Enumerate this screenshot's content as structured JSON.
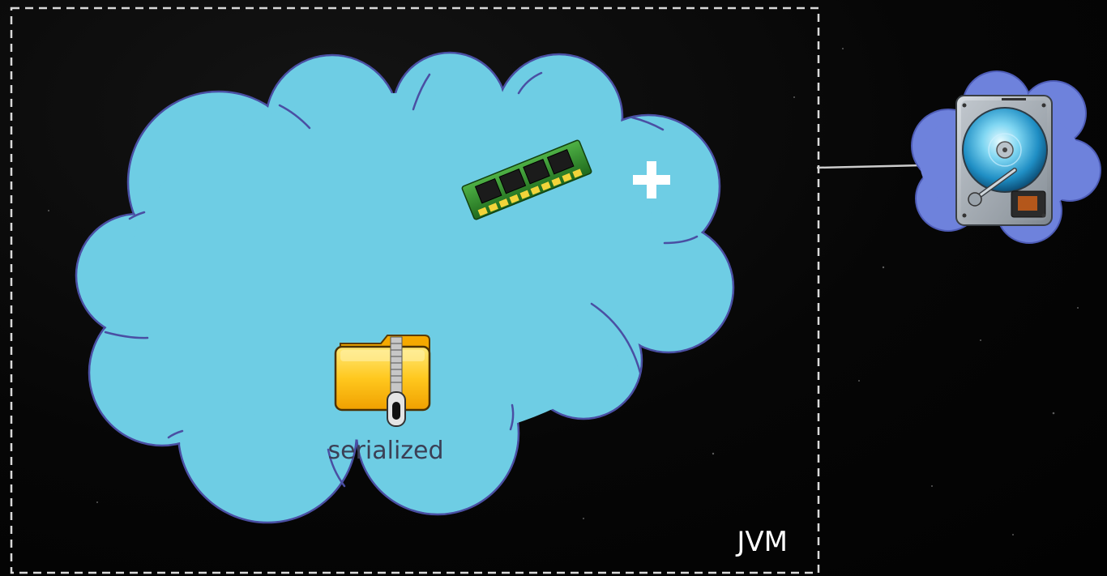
{
  "diagram": {
    "jvm_label": "JVM",
    "serialized_label": "serialized",
    "plus_symbol": "+"
  },
  "icons": {
    "memory": "ram-module-icon",
    "archive": "zipped-folder-icon",
    "disk": "hard-drive-icon"
  },
  "colors": {
    "background": "#050505",
    "jvm_border": "#d9d9d9",
    "main_cloud_fill": "#6ecde4",
    "main_cloud_stroke": "#4a4fa3",
    "disk_cloud_fill": "#6e82dc",
    "disk_cloud_stroke": "#4e5cb7",
    "connector": "#cccccc",
    "label_text": "#3b3f55",
    "jvm_text": "#ffffff"
  }
}
